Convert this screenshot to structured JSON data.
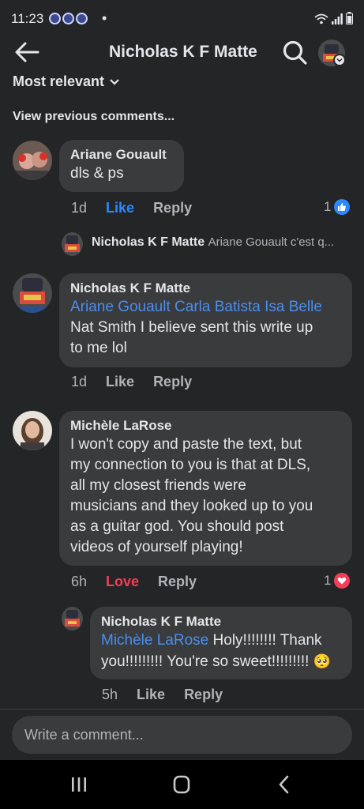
{
  "status": {
    "time": "11:23",
    "dot": "•",
    "icons": [
      "notification-icon",
      "notification-icon",
      "notification-icon",
      "wifi-icon",
      "signal-icon",
      "battery-icon"
    ]
  },
  "header": {
    "title": "Nicholas K F Matte",
    "icons": [
      "back-arrow-icon",
      "search-icon",
      "profile-avatar"
    ]
  },
  "sort": {
    "label": "Most relevant",
    "icon": "chevron-down-icon"
  },
  "view_previous": "View previous comments...",
  "comments": [
    {
      "author": "Ariane Gouault",
      "text": "dls & ps",
      "time": "1d",
      "like_label": "Like",
      "reply_label": "Reply",
      "reaction_count": "1",
      "reaction": "like"
    },
    {
      "author": "Nicholas K F Matte",
      "mentions": "Ariane Gouault Carla Batista Isa Belle",
      "text_line1": "Nat Smith I believe sent this write up",
      "text_line2": "to me lol",
      "time": "1d",
      "like_label": "Like",
      "reply_label": "Reply"
    },
    {
      "author": "Michèle LaRose",
      "lines": [
        "I won't copy and paste the text, but",
        "my connection to you is that at DLS,",
        "all my closest friends were",
        "musicians and they looked up to you",
        "as a guitar god. You should post",
        "videos of yourself playing!"
      ],
      "time": "6h",
      "like_label": "Love",
      "reply_label": "Reply",
      "reaction_count": "1",
      "reaction": "love"
    }
  ],
  "reply_preview": {
    "author": "Nicholas K F Matte",
    "text": "Ariane Gouault c'est q..."
  },
  "reply": {
    "author": "Nicholas K F Matte",
    "mention": "Michèle LaRose",
    "line1_rest": " Holy!!!!!!!! Thank",
    "line2": "you!!!!!!!!! You're so sweet!!!!!!!!! ",
    "emoji": "🥺",
    "time": "5h",
    "like_label": "Like",
    "reply_label": "Reply"
  },
  "composer": {
    "placeholder": "Write a comment..."
  },
  "colors": {
    "background": "#242526",
    "bubble": "#3a3b3c",
    "like_blue": "#2d88ff",
    "love_red": "#f33e58",
    "mention_blue": "#4a8ef1"
  }
}
